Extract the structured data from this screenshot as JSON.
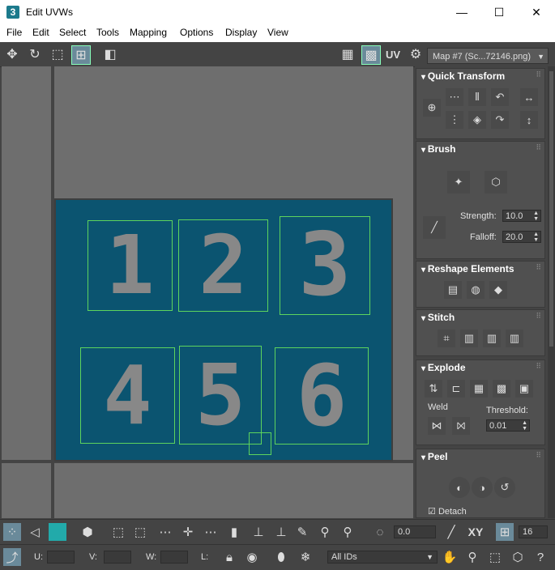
{
  "window": {
    "app_icon": "3",
    "title": "Edit UVWs",
    "minimize": "—",
    "maximize": "☐",
    "close": "✕"
  },
  "menu": [
    "File",
    "Edit",
    "Select",
    "Tools",
    "Mapping",
    "Options",
    "Display",
    "View"
  ],
  "toolbar": {
    "uv_label": "UV",
    "map_select": "Map #7 (Sc...72146.png)",
    "icons": [
      "move-icon",
      "rotate-icon",
      "scale-icon",
      "freeform-icon",
      "mirror-icon",
      "checker-icon",
      "checker-active-icon",
      "uv-toggle-icon",
      "map-settings-icon"
    ]
  },
  "viewport": {
    "digits": [
      "1",
      "2",
      "3",
      "4",
      "5",
      "6"
    ],
    "colors": {
      "tile": "#0b5470",
      "selection": "#5dd45d",
      "background": "#6e6e6e",
      "digit": "#888888"
    }
  },
  "panel": {
    "quick_transform": {
      "title": "Quick Transform"
    },
    "brush": {
      "title": "Brush",
      "strength_label": "Strength:",
      "strength_value": "10.0",
      "falloff_label": "Falloff:",
      "falloff_value": "20.0"
    },
    "reshape": {
      "title": "Reshape Elements"
    },
    "stitch": {
      "title": "Stitch"
    },
    "explode": {
      "title": "Explode",
      "weld_label": "Weld",
      "threshold_label": "Threshold:",
      "threshold_value": "0.01"
    },
    "peel": {
      "title": "Peel",
      "detach_label": "Detach",
      "detach_checked": true
    }
  },
  "bottom": {
    "rotate_value": "0.0",
    "xy_label": "XY",
    "grid_value": "16",
    "u_label": "U:",
    "v_label": "V:",
    "w_label": "W:",
    "l_label": "L:",
    "ids_select": "All IDs"
  }
}
